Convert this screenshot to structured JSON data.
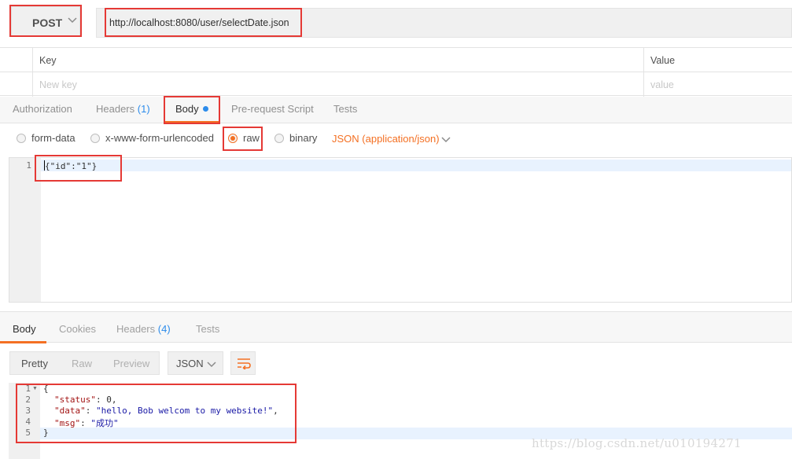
{
  "request": {
    "method": "POST",
    "url": "http://localhost:8080/user/selectDate.json"
  },
  "params": {
    "key_header": "Key",
    "value_header": "Value",
    "key_placeholder": "New key",
    "value_placeholder": "value"
  },
  "request_tabs": {
    "authorization": "Authorization",
    "headers": "Headers",
    "headers_count": "(1)",
    "body": "Body",
    "pre_request_script": "Pre-request Script",
    "tests": "Tests"
  },
  "body_types": {
    "form_data": "form-data",
    "urlencoded": "x-www-form-urlencoded",
    "raw": "raw",
    "binary": "binary",
    "selected": "raw",
    "content_type": "JSON (application/json)"
  },
  "request_body": {
    "line_numbers": [
      "1"
    ],
    "lines": [
      "{\"id\":\"1\"}"
    ]
  },
  "response_tabs": {
    "body": "Body",
    "cookies": "Cookies",
    "headers": "Headers",
    "headers_count": "(4)",
    "tests": "Tests"
  },
  "response_toolbar": {
    "pretty": "Pretty",
    "raw": "Raw",
    "preview": "Preview",
    "format": "JSON"
  },
  "response_body": {
    "line_numbers": [
      "1",
      "2",
      "3",
      "4",
      "5"
    ],
    "line1": "{",
    "status_key": "\"status\"",
    "status_val": "0",
    "data_key": "\"data\"",
    "data_val": "\"hello, Bob welcom to my website!\"",
    "msg_key": "\"msg\"",
    "msg_val": "\"成功\"",
    "line5": "}"
  },
  "watermark": "https://blog.csdn.net/u010194271",
  "colors": {
    "accent": "#f47023",
    "link_blue": "#2d8ceb",
    "annotation_red": "#e53935"
  },
  "icons": {
    "method_dropdown": "chevron-down-icon",
    "content_type_dropdown": "chevron-down-icon",
    "wrap_lines": "wrap-lines-icon"
  }
}
